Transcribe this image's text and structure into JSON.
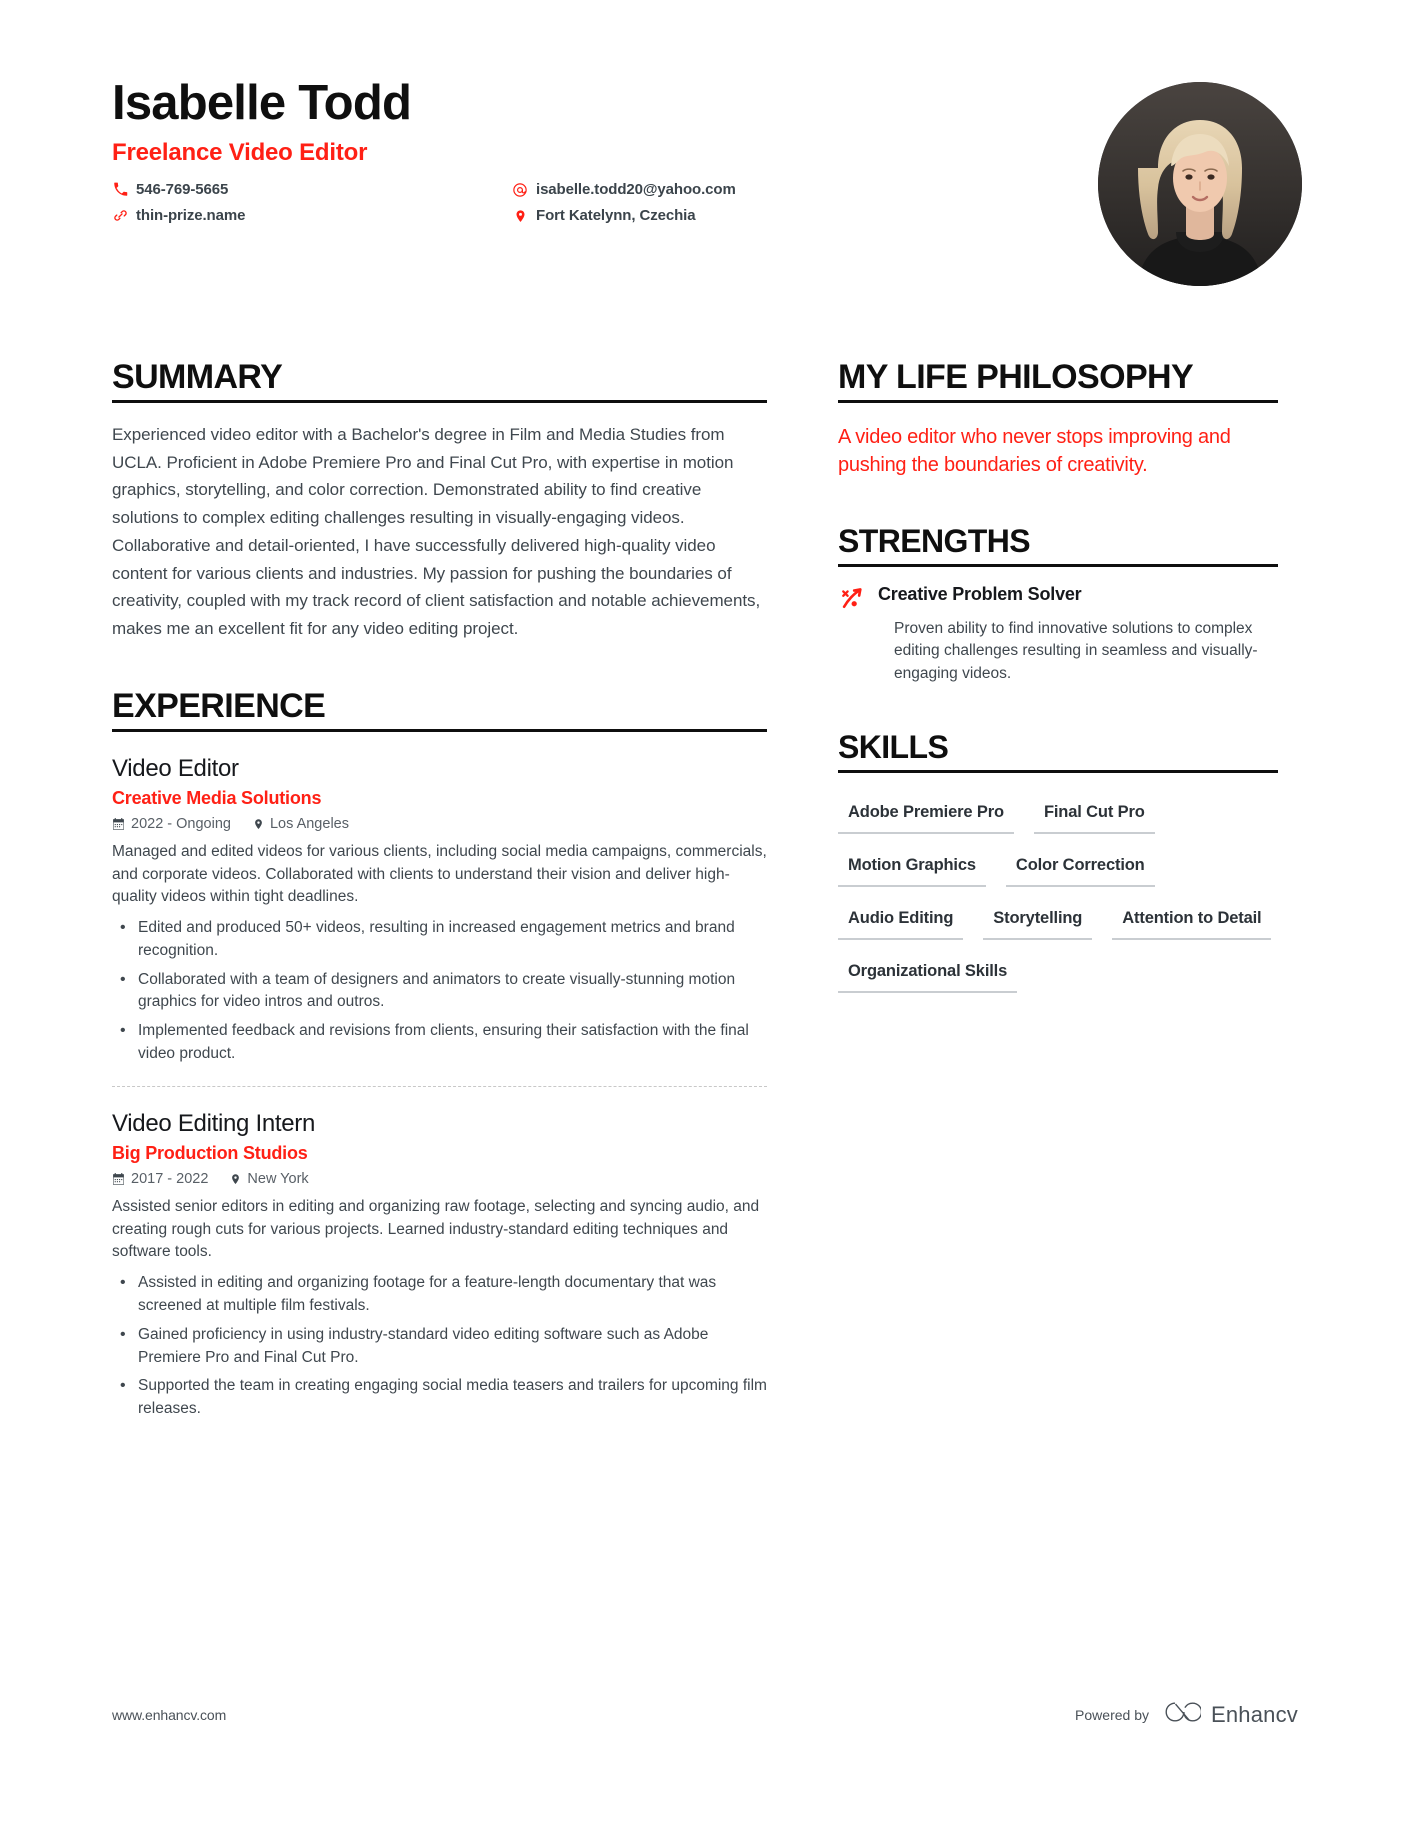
{
  "header": {
    "name": "Isabelle Todd",
    "job_title": "Freelance Video Editor",
    "contacts": [
      {
        "icon": "phone-icon",
        "value": "546-769-5665"
      },
      {
        "icon": "email-icon",
        "value": "isabelle.todd20@yahoo.com"
      },
      {
        "icon": "link-icon",
        "value": "thin-prize.name"
      },
      {
        "icon": "location-pin-icon",
        "value": "Fort Katelynn, Czechia"
      }
    ],
    "photo_alt": "profile-photo"
  },
  "left": {
    "summary": {
      "title": "SUMMARY",
      "text": "Experienced video editor with a Bachelor's degree in Film and Media Studies from UCLA. Proficient in Adobe Premiere Pro and Final Cut Pro, with expertise in motion graphics, storytelling, and color correction. Demonstrated ability to find creative solutions to complex editing challenges resulting in visually-engaging videos. Collaborative and detail-oriented, I have successfully delivered high-quality video content for various clients and industries. My passion for pushing the boundaries of creativity, coupled with my track record of client satisfaction and notable achievements, makes me an excellent fit for any video editing project."
    },
    "experience": {
      "title": "EXPERIENCE",
      "entries": [
        {
          "role": "Video Editor",
          "company": "Creative Media Solutions",
          "dates": "2022 - Ongoing",
          "location": "Los Angeles",
          "description": "Managed and edited videos for various clients, including social media campaigns, commercials, and corporate videos. Collaborated with clients to understand their vision and deliver high-quality videos within tight deadlines.",
          "bullets": [
            "Edited and produced 50+ videos, resulting in increased engagement metrics and brand recognition.",
            "Collaborated with a team of designers and animators to create visually-stunning motion graphics for video intros and outros.",
            "Implemented feedback and revisions from clients, ensuring their satisfaction with the final video product."
          ]
        },
        {
          "role": "Video Editing Intern",
          "company": "Big Production Studios",
          "dates": "2017 - 2022",
          "location": "New York",
          "description": "Assisted senior editors in editing and organizing raw footage, selecting and syncing audio, and creating rough cuts for various projects. Learned industry-standard editing techniques and software tools.",
          "bullets": [
            "Assisted in editing and organizing footage for a feature-length documentary that was screened at multiple film festivals.",
            "Gained proficiency in using industry-standard video editing software such as Adobe Premiere Pro and Final Cut Pro.",
            "Supported the team in creating engaging social media teasers and trailers for upcoming film releases."
          ]
        }
      ]
    }
  },
  "right": {
    "philosophy": {
      "title": "MY LIFE PHILOSOPHY",
      "text": "A video editor who never stops improving and pushing the boundaries of creativity."
    },
    "strengths": {
      "title": "STRENGTHS",
      "items": [
        {
          "icon": "rocket-arrow-icon",
          "name": "Creative Problem Solver",
          "description": "Proven ability to find innovative solutions to complex editing challenges resulting in seamless and visually-engaging videos."
        }
      ]
    },
    "skills": {
      "title": "SKILLS",
      "items": [
        "Adobe Premiere Pro",
        "Final Cut Pro",
        "Motion Graphics",
        "Color Correction",
        "Audio Editing",
        "Storytelling",
        "Attention to Detail",
        "Organizational Skills"
      ]
    }
  },
  "footer": {
    "url": "www.enhancv.com",
    "powered_by": "Powered by",
    "brand": "Enhancv"
  },
  "colors": {
    "accent_red": "#ff2015",
    "text_dark": "#16181c",
    "text_body": "#3f474e",
    "rule": "#0f0f0f"
  }
}
